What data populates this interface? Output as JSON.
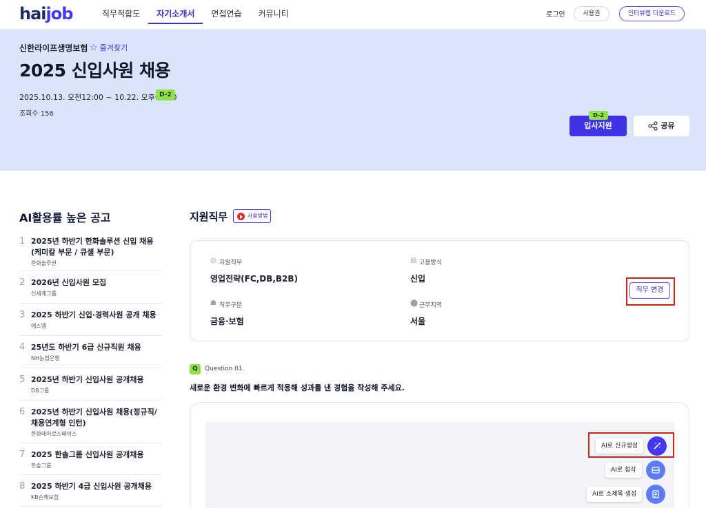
{
  "header": {
    "logo_part1": "hai",
    "logo_part2": "job",
    "nav": [
      "직무적합도",
      "자기소개서",
      "면접연습",
      "커뮤니티"
    ],
    "active_nav": "자기소개서",
    "login": "로그인",
    "voucher": "사용권",
    "download": "인터뷰랩 다운로드"
  },
  "hero": {
    "company": "신한라이프생명보험",
    "favorite": "즐겨찾기",
    "title": "2025 신입사원 채용",
    "period": "2025.10.13. 오전12:00 ~ 10.22. 오후06:00",
    "dday": "D-2",
    "views": "조회수 156",
    "apply": "입사지원",
    "apply_dday": "D-2",
    "share": "공유"
  },
  "sidebar": {
    "title": "AI활용률 높은 공고",
    "items": [
      {
        "num": "1",
        "name": "2025년 하반기 한화솔루션 신입 채용 (케미칼 부문 / 큐셀 부문)",
        "company": "한화솔루션"
      },
      {
        "num": "2",
        "name": "2026년 신입사원 모집",
        "company": "신세계그룹"
      },
      {
        "num": "3",
        "name": "2025 하반기 신입·경력사원 공개 채용",
        "company": "에스엠"
      },
      {
        "num": "4",
        "name": "25년도 하반기 6급 신규직원 채용",
        "company": "NH농협은행"
      },
      {
        "num": "5",
        "name": "2025년 하반기 신입사원 공개채용",
        "company": "DB그룹"
      },
      {
        "num": "6",
        "name": "2025년 하반기 신입사원 채용(정규직/채용연계형 인턴)",
        "company": "한화에어로스페이스"
      },
      {
        "num": "7",
        "name": "2025 한솔그룹 신입사원 공개채용",
        "company": "한솔그룹"
      },
      {
        "num": "8",
        "name": "2025 하반기 4급 신입사원 공개채용",
        "company": "KB손해보험"
      }
    ]
  },
  "main": {
    "section_title": "지원직무",
    "howto": "사용방법",
    "fields": {
      "job_label": "지원직무",
      "job_value": "영업전략(FC,DB,B2B)",
      "type_label": "고용방식",
      "type_value": "신입",
      "category_label": "직무구분",
      "category_value": "금융·보험",
      "region_label": "근무지역",
      "region_value": "서울"
    },
    "change_job": "직무 변경",
    "question_badge": "Q",
    "question_num": "Question 01.",
    "question_text": "새로운 환경 변화에 빠르게 적응해 성과를 낸 경험을 작성해 주세요.",
    "ai_actions": [
      "AI로 신규생성",
      "AI로 첨삭",
      "AI로 소제목 생성"
    ]
  },
  "colors": {
    "brand": "#3f33e6",
    "hero_bg": "#dae4fb",
    "badge_green": "#8fe04c",
    "highlight_red": "#c8281c"
  }
}
